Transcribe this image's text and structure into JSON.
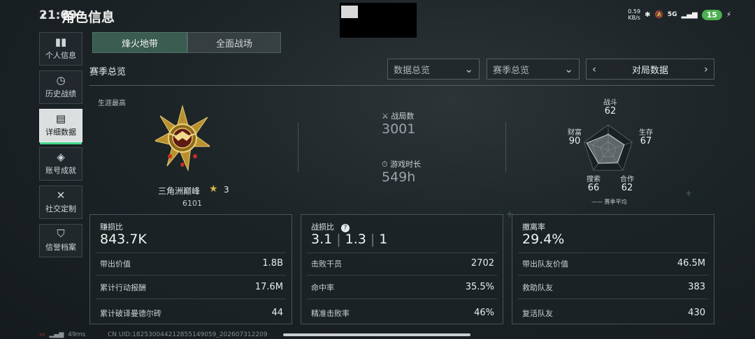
{
  "status_bar": {
    "time": "21:09",
    "net_speed": "0.59",
    "net_unit": "KB/s",
    "network": "5G",
    "battery": "15"
  },
  "header": {
    "title": "角色信息"
  },
  "sidebar": {
    "items": [
      {
        "label": "个人信息",
        "icon": "bar-chart-icon"
      },
      {
        "label": "历史战绩",
        "icon": "clock-icon"
      },
      {
        "label": "详细数据",
        "icon": "folder-icon"
      },
      {
        "label": "账号成就",
        "icon": "diamond-medal-icon"
      },
      {
        "label": "社交定制",
        "icon": "tools-icon"
      },
      {
        "label": "信誉档案",
        "icon": "shield-icon"
      }
    ],
    "active_index": 2
  },
  "tabs": [
    {
      "label": "烽火地带",
      "active": true
    },
    {
      "label": "全面战场",
      "active": false
    }
  ],
  "section": {
    "title": "赛季总览"
  },
  "dropdowns": {
    "data_overview": "数据总览",
    "season_overview": "赛季总览",
    "match_data": "对局数据"
  },
  "career": {
    "label": "生涯最高",
    "rank_name": "三角洲巅峰",
    "stars": "3",
    "score": "6101"
  },
  "mid_stats": {
    "matches_label": "战局数",
    "matches_value": "3001",
    "playtime_label": "游戏时长",
    "playtime_value": "549h"
  },
  "radar": {
    "axes": [
      {
        "label": "战斗",
        "value": 62
      },
      {
        "label": "生存",
        "value": 67
      },
      {
        "label": "合作",
        "value": 62
      },
      {
        "label": "搜索",
        "value": 66
      },
      {
        "label": "财富",
        "value": 90
      }
    ],
    "legend": "赛季平均"
  },
  "cards": {
    "profit": {
      "head": "赚损比",
      "big": "843.7K",
      "rows": [
        {
          "label": "带出价值",
          "value": "1.8B"
        },
        {
          "label": "累计行动报酬",
          "value": "17.6M"
        },
        {
          "label": "累计破译曼德尔砖",
          "value": "44"
        }
      ]
    },
    "combat": {
      "head": "战损比",
      "ratio": [
        "3.1",
        "1.3",
        "1"
      ],
      "help": "?",
      "rows": [
        {
          "label": "击败干员",
          "value": "2702"
        },
        {
          "label": "命中率",
          "value": "35.5%"
        },
        {
          "label": "精准击败率",
          "value": "46%"
        }
      ]
    },
    "extract": {
      "head": "撤离率",
      "big": "29.4%",
      "rows": [
        {
          "label": "带出队友价值",
          "value": "46.5M"
        },
        {
          "label": "救助队友",
          "value": "383"
        },
        {
          "label": "复活队友",
          "value": "430"
        }
      ]
    }
  },
  "footer": {
    "ping": "49ms",
    "uid": "CN UID:182530044212855149059_202607312209"
  },
  "colors": {
    "accent_green": "#3fd68c",
    "tab_active": "#3b5c50",
    "gold": "#d9b54a"
  }
}
